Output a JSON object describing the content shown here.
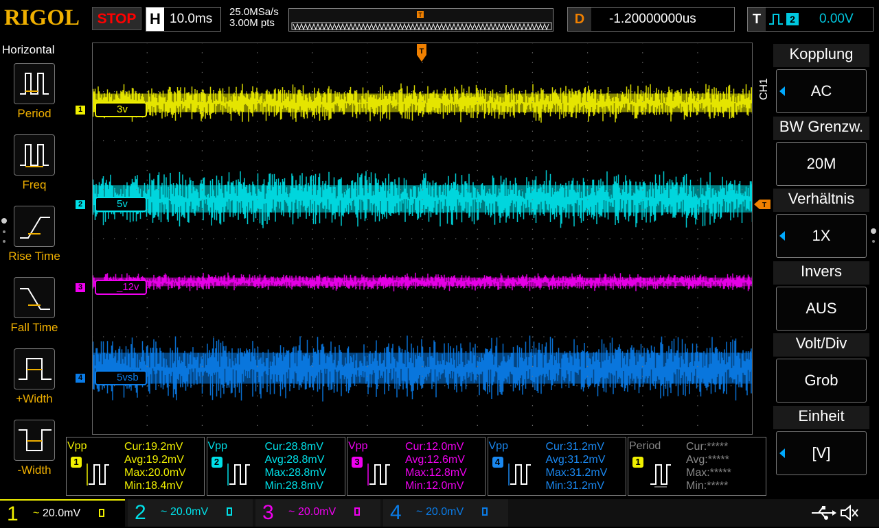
{
  "header": {
    "logo": "RIGOL",
    "run_state": "STOP",
    "h_label": "H",
    "timebase": "10.0ms",
    "sample_rate": "25.0MSa/s",
    "points": "3.00M pts",
    "delay_label": "D",
    "delay_value": "-1.20000000us",
    "trigger_label": "T",
    "trigger_source": "2",
    "trigger_level": "0.00V"
  },
  "left_menu": {
    "title": "Horizontal",
    "items": [
      {
        "label": "Period",
        "icon": "period-icon"
      },
      {
        "label": "Freq",
        "icon": "freq-icon"
      },
      {
        "label": "Rise Time",
        "icon": "rise-time-icon"
      },
      {
        "label": "Fall Time",
        "icon": "fall-time-icon"
      },
      {
        "label": "+Width",
        "icon": "plus-width-icon"
      },
      {
        "label": "-Width",
        "icon": "minus-width-icon"
      }
    ]
  },
  "right_menu": {
    "channel": "CH1",
    "items": [
      {
        "title": "Kopplung",
        "value": "AC",
        "arrow": true
      },
      {
        "title": "BW Grenzw.",
        "value": "20M",
        "arrow": false
      },
      {
        "title": "Verhältnis",
        "value": "1X",
        "arrow": true
      },
      {
        "title": "Invers",
        "value": "AUS",
        "arrow": false
      },
      {
        "title": "Volt/Div",
        "value": "Grob",
        "arrow": false
      },
      {
        "title": "Einheit",
        "value": "[V]",
        "arrow": true
      }
    ]
  },
  "channels": [
    {
      "num": "1",
      "label": "3v",
      "color": "#f0f000",
      "scale": "20.0mV"
    },
    {
      "num": "2",
      "label": "5v",
      "color": "#00e0e8",
      "scale": "20.0mV"
    },
    {
      "num": "3",
      "label": "_12v",
      "color": "#f000f0",
      "scale": "20.0mV"
    },
    {
      "num": "4",
      "label": "5vsb",
      "color": "#0a7ce8",
      "scale": "20.0mV"
    }
  ],
  "measurements": [
    {
      "name": "Vpp",
      "ch": "1",
      "color": "#f0f000",
      "cur": "Cur:19.2mV",
      "avg": "Avg:19.2mV",
      "max": "Max:20.0mV",
      "min": "Min:18.4mV"
    },
    {
      "name": "Vpp",
      "ch": "2",
      "color": "#00e0e8",
      "cur": "Cur:28.8mV",
      "avg": "Avg:28.8mV",
      "max": "Max:28.8mV",
      "min": "Min:28.8mV"
    },
    {
      "name": "Vpp",
      "ch": "3",
      "color": "#f000f0",
      "cur": "Cur:12.0mV",
      "avg": "Avg:12.6mV",
      "max": "Max:12.8mV",
      "min": "Min:12.0mV"
    },
    {
      "name": "Vpp",
      "ch": "4",
      "color": "#1a88f0",
      "cur": "Cur:31.2mV",
      "avg": "Avg:31.2mV",
      "max": "Max:31.2mV",
      "min": "Min:31.2mV"
    },
    {
      "name": "Period",
      "ch": "1",
      "color": "#888888",
      "cur": "Cur:*****",
      "avg": "Avg:*****",
      "max": "Max:*****",
      "min": "Min:*****"
    }
  ],
  "bottom": {
    "coupling_symbol": "~",
    "usb_icon": "usb-icon",
    "speaker_icon": "speaker-muted-icon"
  }
}
